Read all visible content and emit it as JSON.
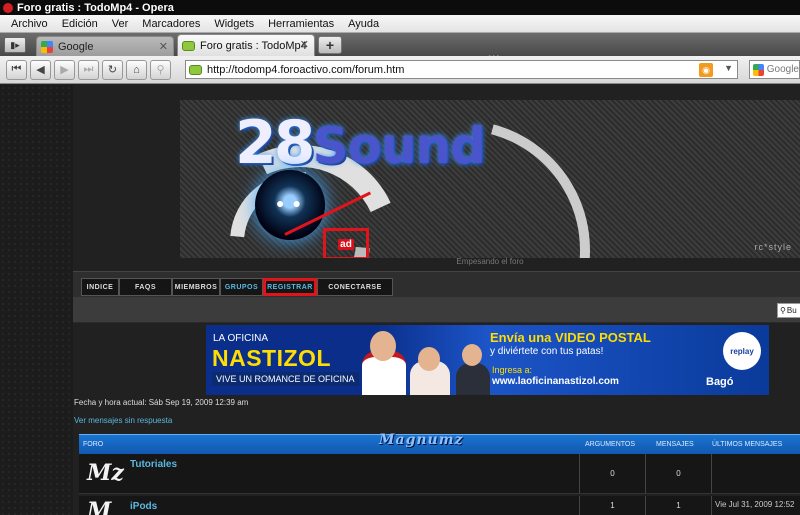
{
  "window": {
    "title": "Foro gratis : TodoMp4 - Opera"
  },
  "menu": [
    "Archivo",
    "Edición",
    "Ver",
    "Marcadores",
    "Widgets",
    "Herramientas",
    "Ayuda"
  ],
  "tabs": [
    {
      "label": "Google",
      "active": false
    },
    {
      "label": "Foro gratis : TodoMp4",
      "active": true
    }
  ],
  "address": {
    "url": "http://todomp4.foroactivo.com/forum.htm",
    "search_placeholder": "Google"
  },
  "banner": {
    "title_main": "28",
    "title_word": "Sound",
    "ad_label": "ad",
    "rc_style": "rc*style"
  },
  "site": {
    "subtitle": "Empesando el foro"
  },
  "nav": [
    "INDICE",
    "FAQS",
    "MIEMBROS",
    "GRUPOS",
    "REGISTRAR",
    "CONECTARSE"
  ],
  "search_button": "Bu",
  "ad": {
    "la_oficina": "LA OFICINA",
    "brand": "NASTIZOL",
    "tagline": "VIVE UN ROMANCE DE OFICINA",
    "video_title": "Envía una VIDEO POSTAL",
    "video_sub": "y diviértete con tus patas!",
    "ingresa": "Ingresa a:",
    "url": "www.laoficinanastizol.com",
    "replay": "replay",
    "sponsor": "Bagó"
  },
  "status": {
    "datetime": "Fecha y hora actual: Sáb Sep 19, 2009 12:39 am",
    "unanswered": "Ver mensajes sin respuesta"
  },
  "forum": {
    "headers": {
      "forum": "FORO",
      "args": "ARGUMENTOS",
      "msgs": "MENSAJES",
      "last": "ÚLTIMOS MENSAJES"
    },
    "logo": "Magnumz",
    "rows": [
      {
        "name": "Tutoriales",
        "args": "0",
        "msgs": "0",
        "last": ""
      },
      {
        "name": "iPods",
        "args": "1",
        "msgs": "1",
        "last": "Vie Jul 31, 2009 12:52"
      }
    ]
  },
  "colors": {
    "accent_link": "#5ab8e0",
    "highlight_red": "#e0151b",
    "header_blue": "#1a74d1"
  }
}
